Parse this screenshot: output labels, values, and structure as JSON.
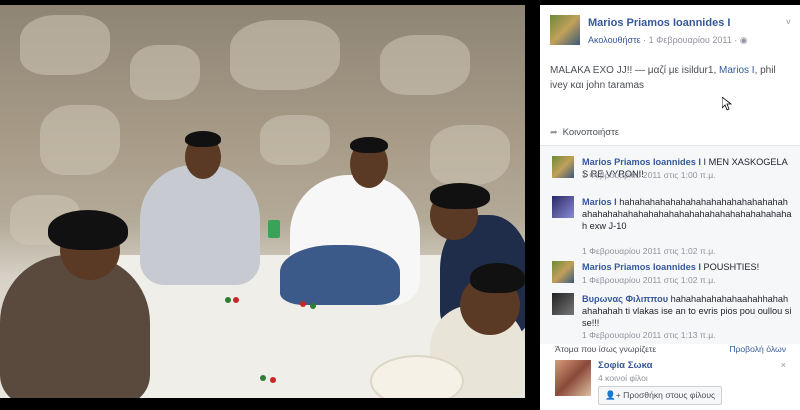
{
  "post": {
    "author": "Marios Priamos Ioannides I",
    "follow_label": "Ακολουθήστε",
    "date": "· 1 Φεβρουαρίου 2011 ·",
    "chevron": "˅",
    "text_prefix": "MALAKA EXO JJ!! — μαζί με isildur1, ",
    "text_link": "Marios I",
    "text_suffix": ", phil ivey και john taramas",
    "share_label": "Κοινοποιήστε"
  },
  "comments": [
    {
      "name": "Marios Priamos Ioannides I",
      "text": " I MEN XASKOGELAS RE VYRONI!",
      "date": "1 Φεβρουαρίου 2011 στις 1:00 π.μ."
    },
    {
      "name": "Marios I",
      "text": " hahahahahahahahahahahahahahahahahahahahahahahahahahahahahahahahahahahahahah exw J-10",
      "date": "1 Φεβρουαρίου 2011 στις 1:02 π.μ."
    },
    {
      "name": "Marios Priamos Ioannides I",
      "text": " POUSHTIES!",
      "date": "1 Φεβρουαρίου 2011 στις 1:02 π.μ."
    },
    {
      "name": "Βυρωνας Φιλιππου",
      "text": " hahahahahahahaahahhahahahahahah ti vlakas ise an to evris pios pou oullou sise!!!",
      "date": "1 Φεβρουαρίου 2011 στις 1:13 π.μ."
    }
  ],
  "suggestions": {
    "heading": "Άτομα που ίσως γνωρίζετε",
    "see_all": "Προβολή όλων",
    "person_name": "Σοφία Σωκα",
    "mutual": "4 κοινοί φίλοι",
    "add_button": "Προσθήκη στους φίλους",
    "close": "×"
  },
  "colors": {
    "link": "#365899",
    "muted": "#90949c",
    "comments_bg": "#f6f7f9"
  }
}
